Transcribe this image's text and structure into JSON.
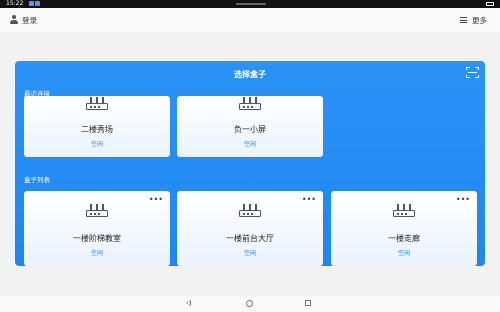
{
  "status_bar": {
    "time": "15:22"
  },
  "header": {
    "login_label": "登录",
    "more_label": "更多"
  },
  "panel": {
    "title": "选择盒子",
    "recent_label": "最近连接",
    "list_label": "盒子列表",
    "recent": [
      {
        "name": "二楼秀场",
        "status": "空闲"
      },
      {
        "name": "负一小屏",
        "status": "空闲"
      }
    ],
    "boxes": [
      {
        "name": "一楼阶梯教室",
        "status": "空闲",
        "more": "•••"
      },
      {
        "name": "一楼前台大厅",
        "status": "空闲",
        "more": "•••"
      },
      {
        "name": "一楼走廊",
        "status": "空闲",
        "more": "•••"
      }
    ]
  },
  "colors": {
    "accent": "#1e86f2",
    "card_bg": "#ffffff",
    "page_bg": "#f2f2f2"
  },
  "icons": [
    "user-icon",
    "menu-icon",
    "scan-icon",
    "router-icon",
    "more-dots-icon",
    "nav-back-icon",
    "nav-home-icon",
    "nav-recent-icon"
  ]
}
